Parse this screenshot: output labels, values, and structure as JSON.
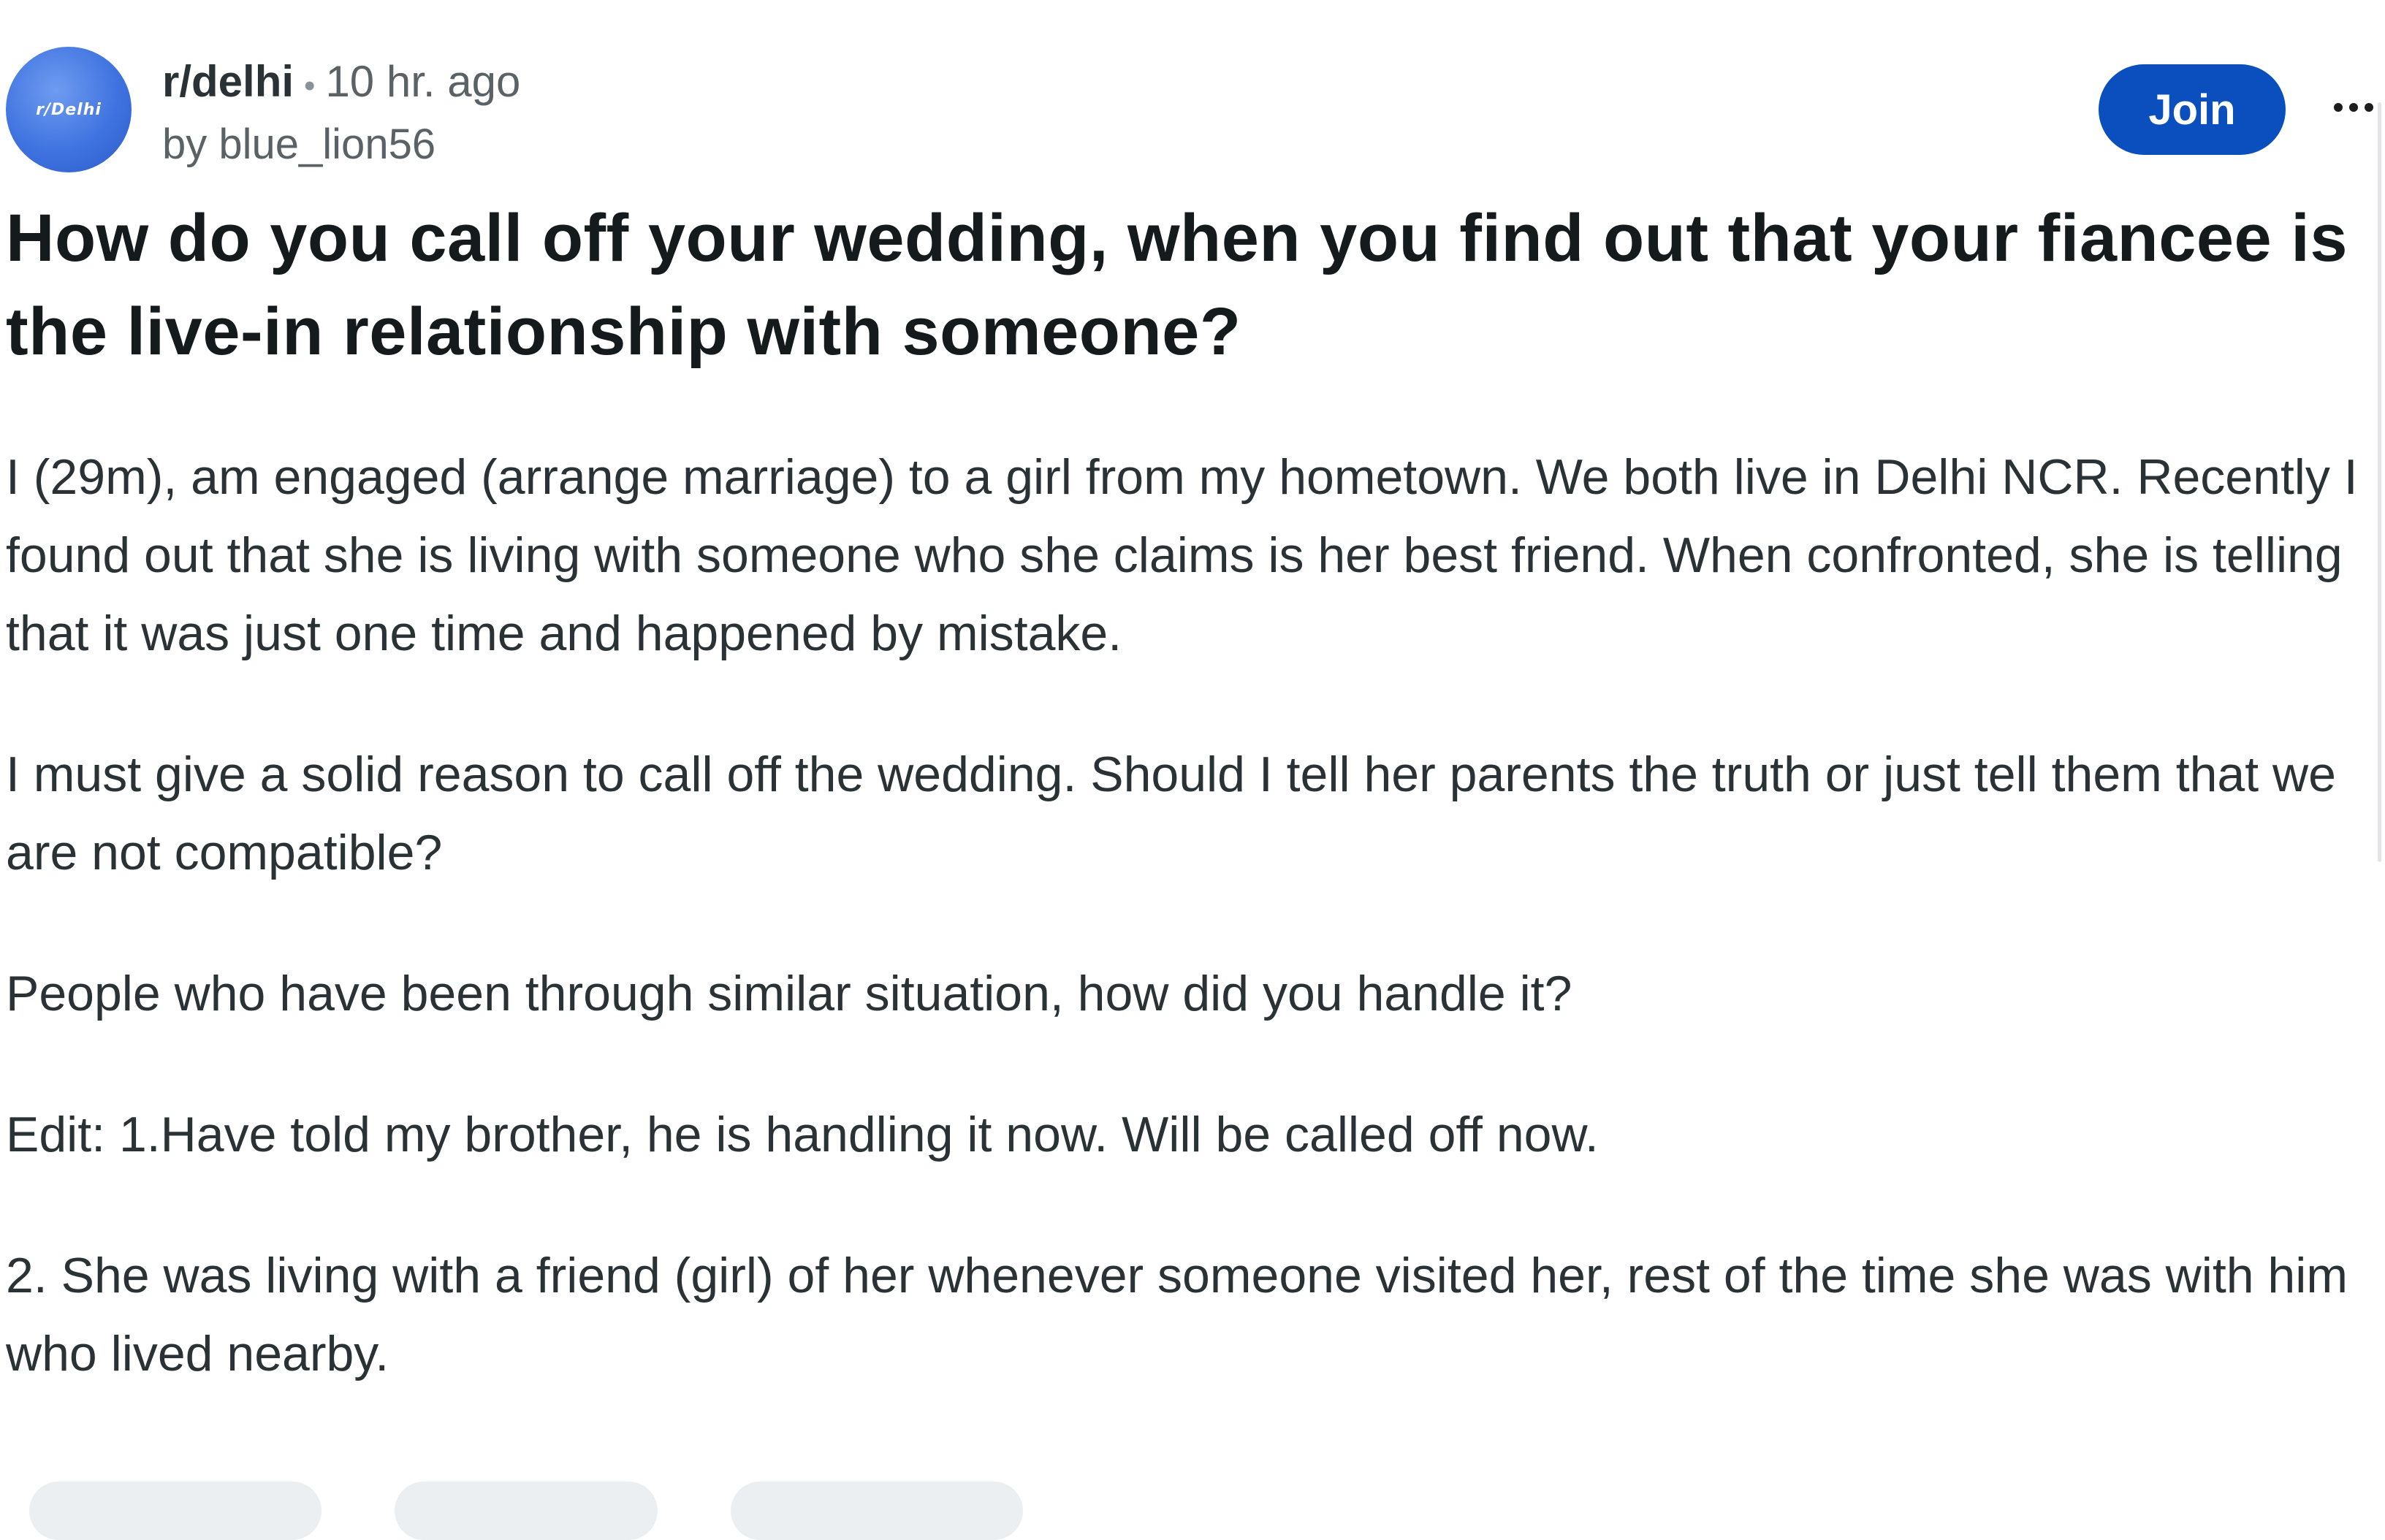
{
  "header": {
    "avatar_label": "r/Delhi",
    "subreddit": "r/delhi",
    "separator": "•",
    "timestamp": "10 hr. ago",
    "author": "by blue_lion56",
    "join_label": "Join",
    "more_icon": "more-horizontal-icon"
  },
  "post": {
    "title": "How do you call off your wedding, when you find out that your fiancee is the live-in relationship with someone?",
    "paragraphs": [
      "I (29m), am engaged (arrange marriage) to a girl from my hometown. We both live in Delhi NCR. Recently I found out that she is living with someone who she claims is her best friend. When confronted, she is telling that it was just one time and happened by mistake.",
      "I must give a solid reason to call off the wedding. Should I tell her parents the truth or just tell them that we are not compatible?",
      "People who have been through similar situation, how did you handle it?",
      "Edit: 1.Have told my brother, he is handling it now. Will be called off now.",
      "2. She was living with a friend (girl) of her whenever someone visited her, rest of the time she was with him who lived nearby."
    ]
  },
  "colors": {
    "join_button": "#0b4fbf",
    "avatar": "#3f73e0",
    "text": "#2a3236",
    "muted": "#5a6266"
  }
}
